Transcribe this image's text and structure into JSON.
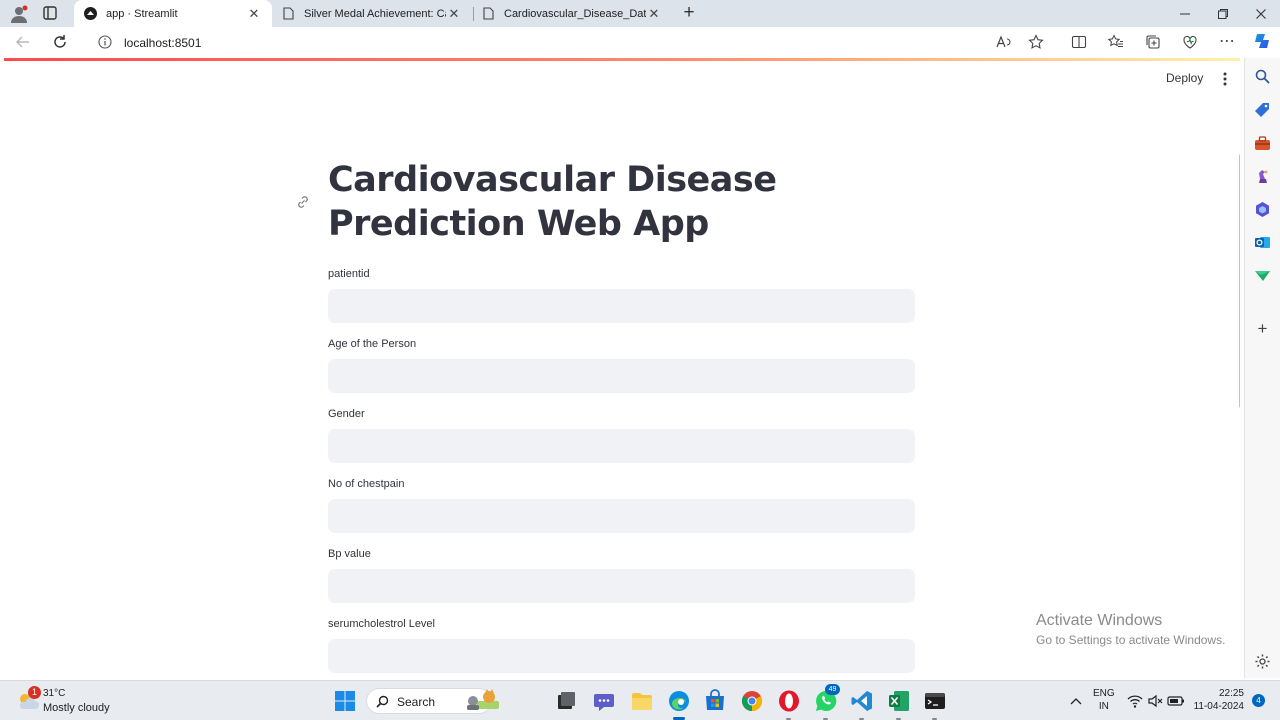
{
  "browser": {
    "tabs": [
      {
        "title": "app · Streamlit",
        "icon": "streamlit-icon",
        "active": true
      },
      {
        "title": "Silver Medal Achievement: Cardi",
        "icon": "page-icon",
        "active": false
      },
      {
        "title": "Cardiovascular_Disease_Dataset",
        "icon": "page-icon",
        "active": false
      }
    ],
    "new_tab_label": "+",
    "url": "localhost:8501"
  },
  "app": {
    "deploy_label": "Deploy",
    "title": "Cardiovascular Disease Prediction Web App",
    "fields": [
      {
        "label": "patientid",
        "value": ""
      },
      {
        "label": "Age of the Person",
        "value": ""
      },
      {
        "label": "Gender",
        "value": ""
      },
      {
        "label": "No of chestpain",
        "value": ""
      },
      {
        "label": "Bp value",
        "value": ""
      },
      {
        "label": "serumcholestrol Level",
        "value": ""
      }
    ]
  },
  "watermark": {
    "line1": "Activate Windows",
    "line2": "Go to Settings to activate Windows."
  },
  "taskbar": {
    "weather_badge": "1",
    "temperature": "31°C",
    "condition": "Mostly cloudy",
    "search_label": "Search",
    "whatsapp_badge": "49",
    "lang_line1": "ENG",
    "lang_line2": "IN",
    "time": "22:25",
    "date": "11-04-2024",
    "notification_count": "4"
  },
  "colors": {
    "accent_red": "#ff4b4b",
    "text": "#31333f",
    "input_bg": "#f0f2f6",
    "taskbar_accent": "#0067c0"
  }
}
